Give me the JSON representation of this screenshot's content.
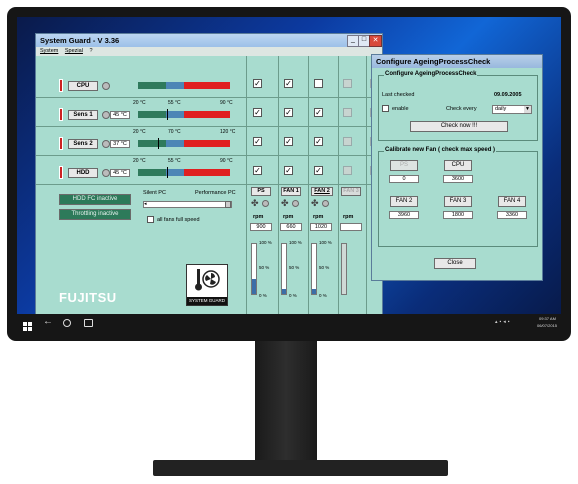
{
  "main_window": {
    "title": "System Guard - V 3.36",
    "menu": [
      "System",
      "Spezial",
      "?"
    ],
    "sensors": [
      {
        "label": "CPU",
        "temp": "",
        "scale": [],
        "level": 0.45
      },
      {
        "label": "Sens 1",
        "temp": "45 °C",
        "scale": [
          "20 °C",
          "55 °C",
          "90 °C"
        ],
        "level": 0.45
      },
      {
        "label": "Sens 2",
        "temp": "37 °C",
        "scale": [
          "20 °C",
          "70 °C",
          "120 °C"
        ],
        "level": 0.35
      },
      {
        "label": "HDD",
        "temp": "45 °C",
        "scale": [
          "20 °C",
          "55 °C",
          "90 °C"
        ],
        "level": 0.45
      }
    ],
    "buttons": {
      "hdd_fc": "HDD FC inactive",
      "throttling": "Throttling inactive"
    },
    "slider": {
      "left_label": "Silent PC",
      "right_label": "Performance PC",
      "all_fans_label": "all fans full speed"
    },
    "fans": [
      {
        "label": "PS",
        "rpm_label": "rpm",
        "rpm": "900",
        "scale": [
          "100 %",
          "50 %",
          "0 %"
        ],
        "level": 0.3
      },
      {
        "label": "FAN 1",
        "rpm_label": "rpm",
        "rpm": "660",
        "scale": [
          "100 %",
          "50 %",
          "0 %"
        ],
        "level": 0.1
      },
      {
        "label": "FAN 2",
        "rpm_label": "rpm",
        "rpm": "1020",
        "scale": [
          "100 %",
          "50 %",
          "0 %"
        ],
        "level": 0.1
      },
      {
        "label": "FAN 3",
        "rpm_label": "rpm",
        "rpm": "",
        "scale": [],
        "level": 0
      },
      {
        "label": "",
        "rpm_label": "",
        "rpm": "",
        "scale": [],
        "level": 0
      }
    ],
    "checkbox_grid": [
      [
        true,
        true,
        false,
        false,
        false
      ],
      [
        true,
        true,
        true,
        false,
        false
      ],
      [
        true,
        true,
        true,
        false,
        false
      ],
      [
        true,
        true,
        true,
        false,
        false
      ]
    ],
    "logo": "FUJITSU",
    "badge": "SYSTEM GUARD"
  },
  "dialog": {
    "title": "Configure AgeingProcessCheck",
    "group1_title": "Configure AgeingProcessCheck",
    "last_checked_label": "Last checked",
    "last_checked_value": "09.09.2005",
    "enable_label": "enable",
    "check_every_label": "Check every",
    "check_every_value": "daily",
    "check_now_button": "Check now !!!",
    "group2_title": "Calibrate new Fan ( check max speed )",
    "calib": [
      {
        "button": "PS",
        "value": "0",
        "disabled": true
      },
      {
        "button": "CPU",
        "value": "3600",
        "disabled": false
      },
      {
        "button": "FAN 2",
        "value": "3960",
        "disabled": false
      },
      {
        "button": "FAN 3",
        "value": "1800",
        "disabled": false
      },
      {
        "button": "FAN 4",
        "value": "3360",
        "disabled": false
      }
    ],
    "close_button": "Close"
  },
  "taskbar": {
    "time": "09:37 AM",
    "date": "06/07/2015"
  },
  "colors": {
    "window_bg": "#a8dccf",
    "bar_green": "#2f7a5c",
    "bar_blue": "#4d86b6",
    "bar_red": "#e02020",
    "desktop": "#0c3aa0"
  }
}
